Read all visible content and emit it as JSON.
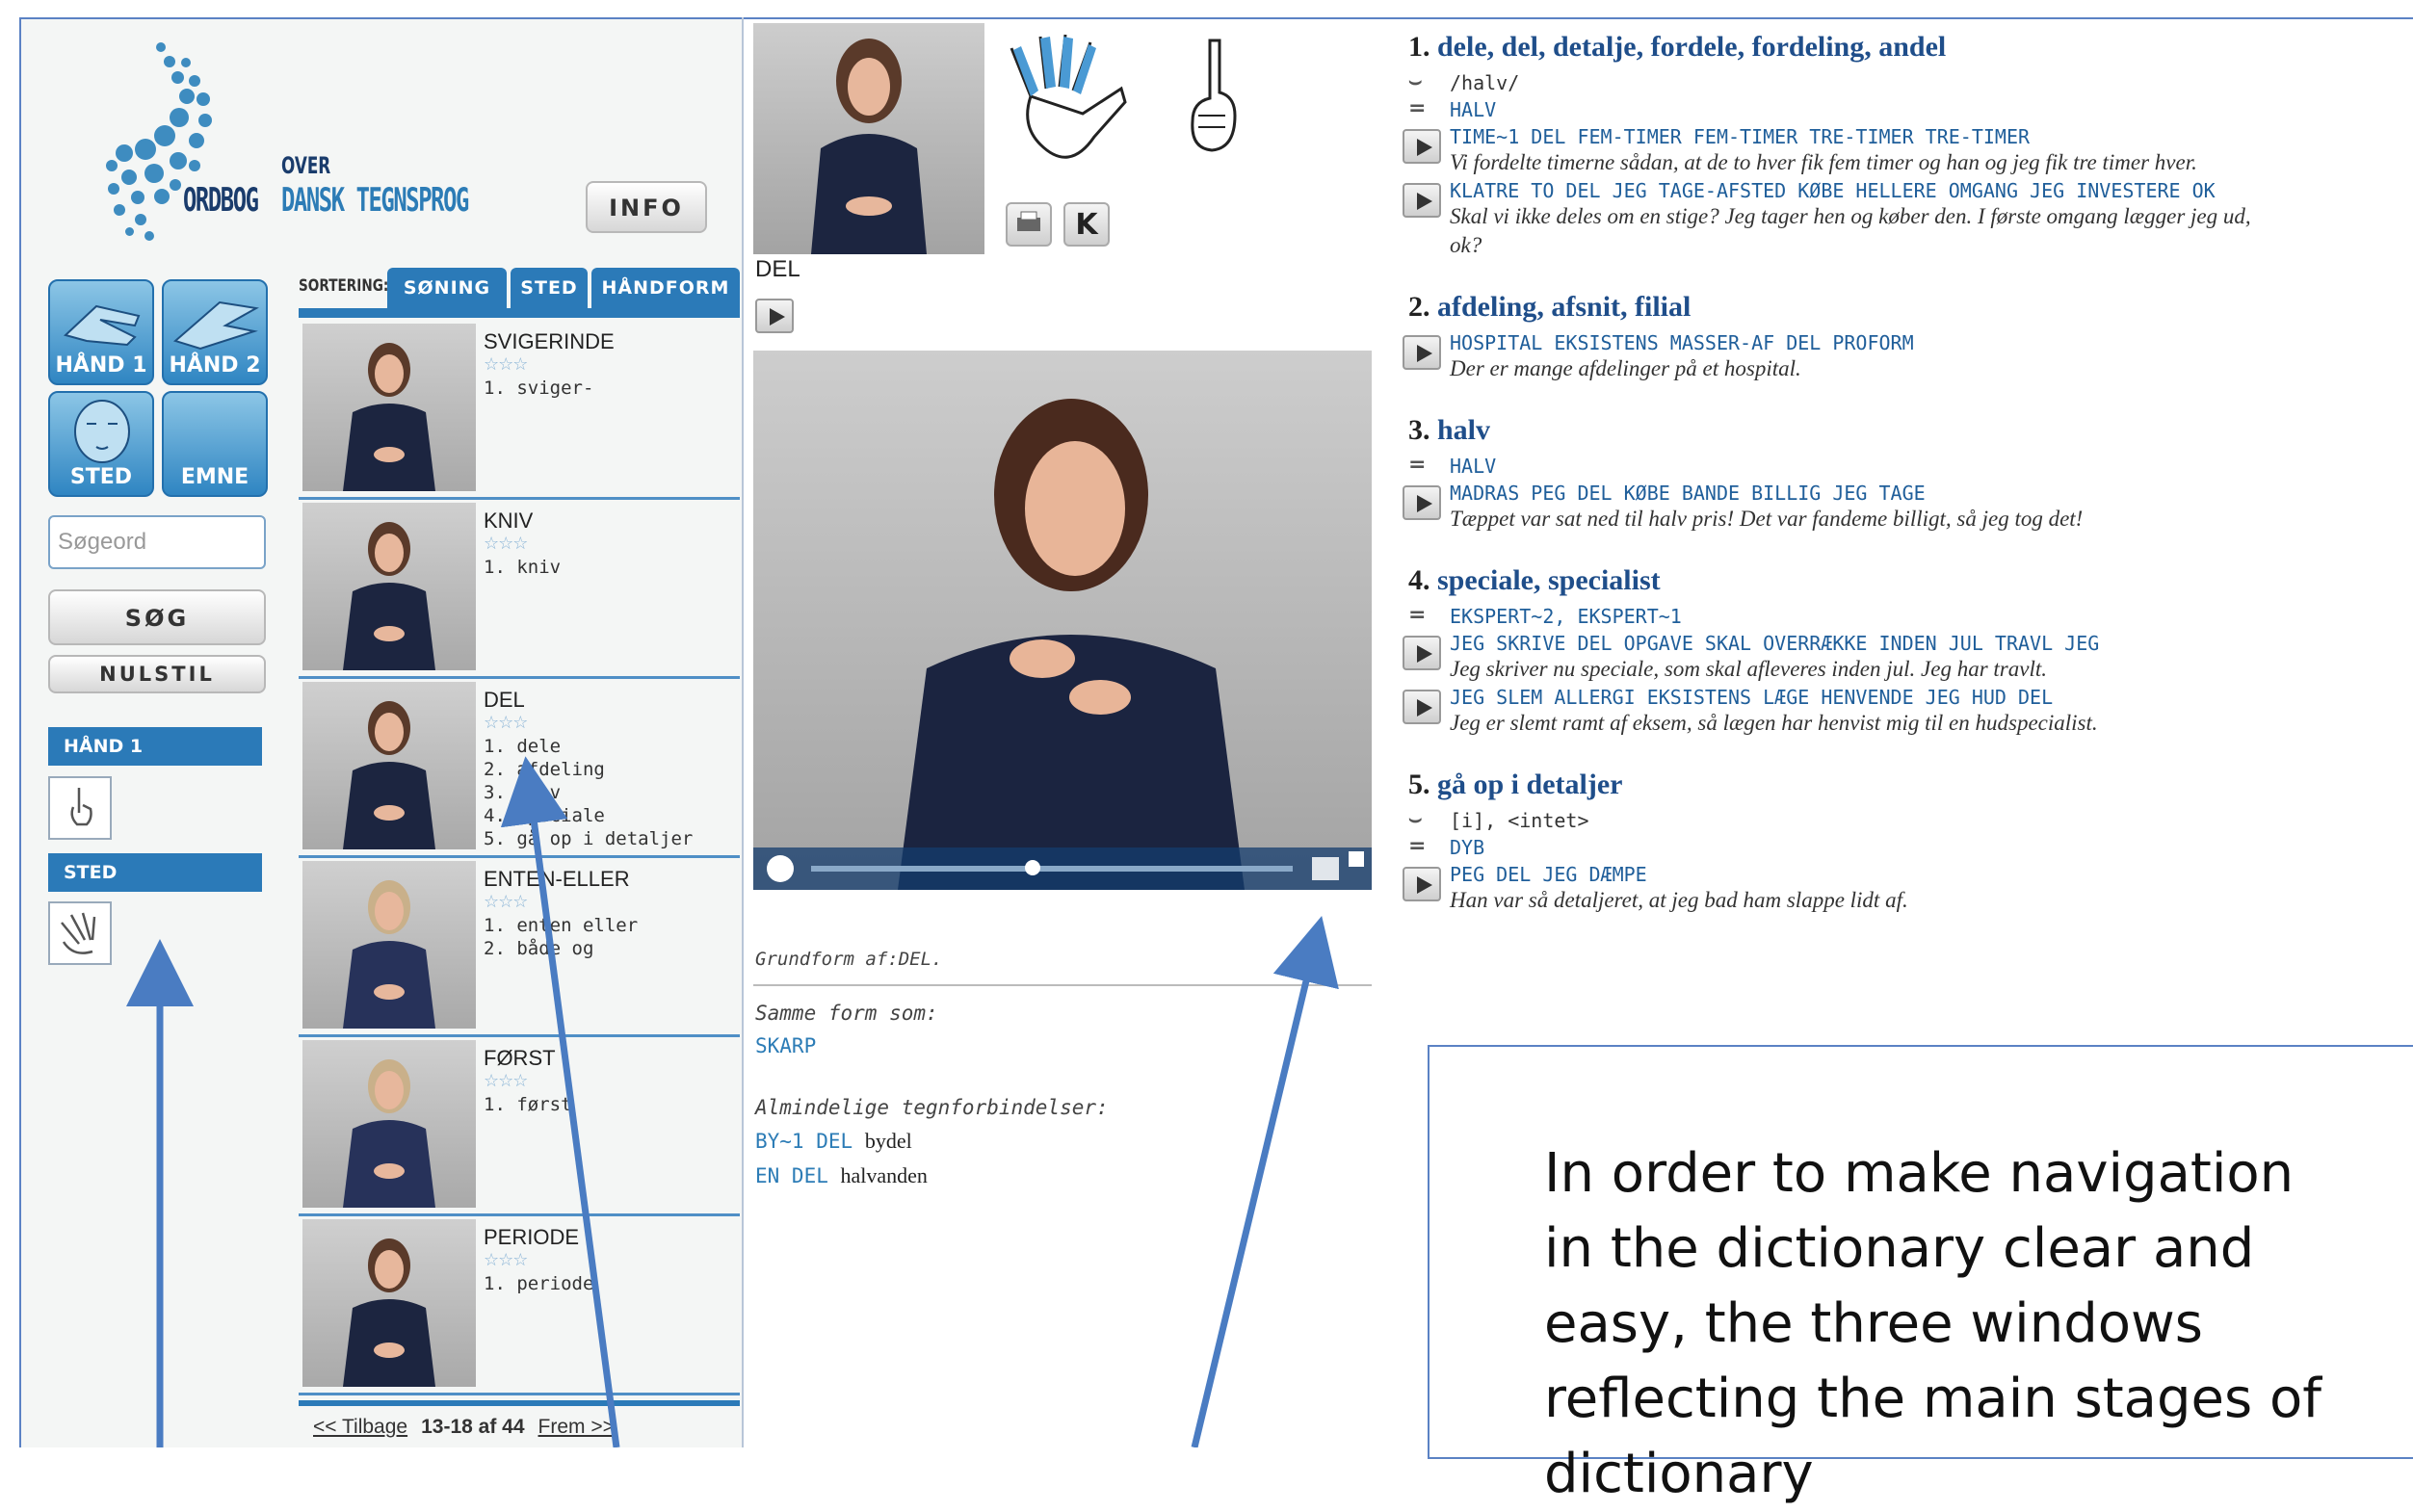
{
  "logo": {
    "ordbog": "ORDBOG",
    "over": "OVER",
    "dansk": "DANSK TEGNSPROG"
  },
  "info_button": "INFO",
  "tiles": [
    "HÅND 1",
    "HÅND 2",
    "STED",
    "EMNE"
  ],
  "search": {
    "placeholder": "Søgeord",
    "search_button": "SØG",
    "reset_button": "NULSTIL"
  },
  "filters": [
    {
      "label": "HÅND 1"
    },
    {
      "label": "STED"
    }
  ],
  "sort": {
    "label": "SORTERING:",
    "tabs": [
      "SØNING",
      "STED",
      "HÅNDFORM"
    ]
  },
  "results": [
    {
      "title": "SVIGERINDE",
      "stars": "☆☆☆",
      "senses": [
        "1. sviger-"
      ]
    },
    {
      "title": "KNIV",
      "stars": "☆☆☆",
      "senses": [
        "1. kniv"
      ]
    },
    {
      "title": "DEL",
      "stars": "☆☆☆",
      "senses": [
        "1. dele",
        "2. afdeling",
        "3. halv",
        "4. speciale",
        "5. gå op i detaljer"
      ]
    },
    {
      "title": "ENTEN-ELLER",
      "stars": "☆☆☆",
      "senses": [
        "1. enten eller",
        "2. både og"
      ]
    },
    {
      "title": "FØRST",
      "stars": "☆☆☆",
      "senses": [
        "1. først"
      ]
    },
    {
      "title": "PERIODE",
      "stars": "☆☆☆",
      "senses": [
        "1. periode"
      ]
    }
  ],
  "pager": {
    "back": "<< Tilbage",
    "range": "13-18 af 44",
    "next": "Frem >>"
  },
  "entry": {
    "headword": "DEL",
    "buttons": {
      "k": "K"
    },
    "grundform_label": "Grundform af:",
    "grundform_value": "DEL.",
    "same_form_label": "Samme form som:",
    "same_form_link": "SKARP",
    "common_label": "Almindelige tegnforbindelser:",
    "combos": [
      {
        "sign": "BY~1 DEL",
        "word": "bydel"
      },
      {
        "sign": "EN DEL",
        "word": "halvanden"
      }
    ]
  },
  "senses": [
    {
      "num": "1.",
      "words": "dele, del, detalje, fordele, fordeling, andel",
      "mouth": "/halv/",
      "eq": "HALV",
      "examples": [
        {
          "gloss": "TIME~1 DEL FEM-TIMER FEM-TIMER TRE-TIMER TRE-TIMER",
          "text": "Vi fordelte timerne sådan, at de to hver fik fem timer og han og jeg fik tre timer hver."
        },
        {
          "gloss": "KLATRE TO DEL JEG TAGE-AFSTED KØBE HELLERE OMGANG JEG INVESTERE OK",
          "text": "Skal vi ikke deles om en stige? Jeg tager hen og køber den. I første omgang lægger jeg ud,",
          "text2": "ok?"
        }
      ]
    },
    {
      "num": "2.",
      "words": "afdeling, afsnit, filial",
      "examples": [
        {
          "gloss": "HOSPITAL EKSISTENS MASSER-AF DEL PROFORM",
          "text": "Der er mange afdelinger på et hospital."
        }
      ]
    },
    {
      "num": "3.",
      "words": "halv",
      "eq": "HALV",
      "examples": [
        {
          "gloss": "MADRAS PEG DEL KØBE BANDE BILLIG JEG TAGE",
          "text": "Tæppet var sat ned til halv pris! Det var fandeme billigt, så jeg tog det!"
        }
      ]
    },
    {
      "num": "4.",
      "words": "speciale, specialist",
      "eq": "EKSPERT~2, EKSPERT~1",
      "examples": [
        {
          "gloss": "JEG SKRIVE DEL OPGAVE SKAL OVERRÆKKE INDEN JUL TRAVL JEG",
          "text": "Jeg skriver nu speciale, som skal afleveres inden jul. Jeg har travlt."
        },
        {
          "gloss": "JEG SLEM ALLERGI EKSISTENS LÆGE HENVENDE JEG HUD DEL",
          "text": "Jeg er slemt ramt af eksem, så lægen har henvist mig til en hudspecialist."
        }
      ]
    },
    {
      "num": "5.",
      "words": "gå op i detaljer",
      "mouth": "[i], <intet>",
      "eq": "DYB",
      "examples": [
        {
          "gloss": "PEG DEL JEG DÆMPE",
          "text": "Han var så detaljeret, at jeg bad ham slappe lidt af."
        }
      ]
    }
  ],
  "callout": "In order to make navigation in the dictionary clear and easy, the three windows reflecting the main stages of dictionary",
  "colors": {
    "accent": "#2b7ab8",
    "gloss": "#1f5e9a",
    "arrow": "#4a7cc2"
  }
}
